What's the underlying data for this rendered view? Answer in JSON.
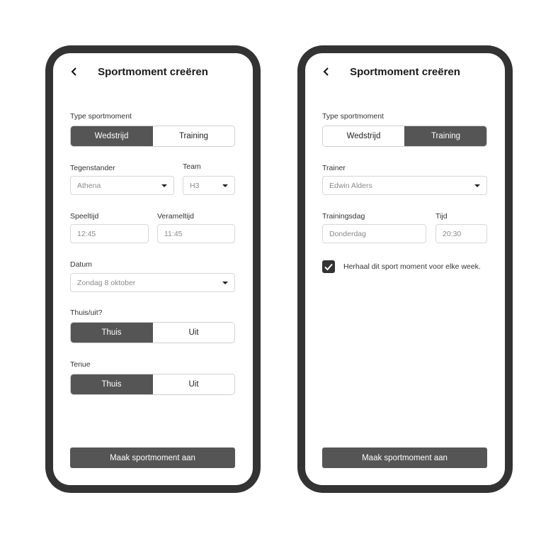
{
  "left": {
    "title": "Sportmoment creëren",
    "type_label": "Type sportmoment",
    "type_options": [
      "Wedstrijd",
      "Training"
    ],
    "type_selected": "Wedstrijd",
    "tegenstander_label": "Tegenstander",
    "tegenstander_value": "Athena",
    "team_label": "Team",
    "team_value": "H3",
    "speeltijd_label": "Speeltijd",
    "speeltijd_value": "12:45",
    "verameltijd_label": "Verameltijd",
    "verameltijd_value": "11:45",
    "datum_label": "Datum",
    "datum_value": "Zondag 8 oktober",
    "thuisuit_label": "Thuis/uit?",
    "thuisuit_options": [
      "Thuis",
      "Uit"
    ],
    "thuisuit_selected": "Thuis",
    "tenue_label": "Tenue",
    "tenue_options": [
      "Thuis",
      "Uit"
    ],
    "tenue_selected": "Thuis",
    "submit_label": "Maak sportmoment aan"
  },
  "right": {
    "title": "Sportmoment creëren",
    "type_label": "Type sportmoment",
    "type_options": [
      "Wedstrijd",
      "Training"
    ],
    "type_selected": "Training",
    "trainer_label": "Trainer",
    "trainer_value": "Edwin Alders",
    "trainingsdag_label": "Trainingsdag",
    "trainingsdag_value": "Donderdag",
    "tijd_label": "Tijd",
    "tijd_value": "20:30",
    "repeat_label": "Herhaal dit sport moment voor elke week.",
    "repeat_checked": true,
    "submit_label": "Maak sportmoment aan"
  },
  "icons": {
    "back": "chevron-left-icon",
    "dropdown": "caret-down-icon",
    "checkbox": "checkmark-icon"
  },
  "colors": {
    "frame": "#333333",
    "active": "#555555",
    "border": "#cfcfcf"
  }
}
